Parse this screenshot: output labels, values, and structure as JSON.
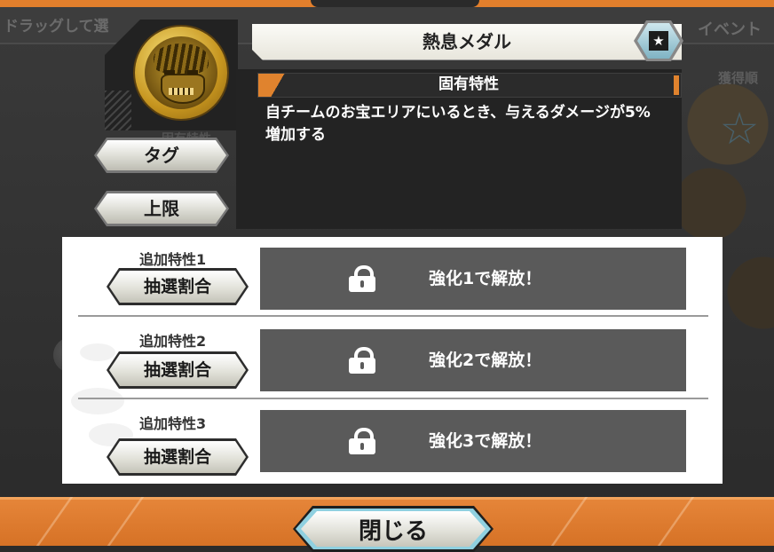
{
  "background": {
    "left_hint": "ドラッグして選",
    "right_hint": "イベント",
    "right_sub": "獲得順",
    "left_sub": "固有特性"
  },
  "medal": {
    "name": "熱息メダル",
    "icon": "medal-portrait-icon",
    "favorite_icon": "star-icon",
    "favorite_glyph": "★"
  },
  "tabs": {
    "tag_label": "タグ",
    "limit_label": "上限"
  },
  "unique_trait": {
    "heading": "固有特性",
    "description": "自チームのお宝エリアにいるとき、与えるダメージが5%増加する"
  },
  "additional_traits": [
    {
      "label": "追加特性1",
      "button_label": "抽選割合",
      "locked_text": "強化1で解放！"
    },
    {
      "label": "追加特性2",
      "button_label": "抽選割合",
      "locked_text": "強化2で解放！"
    },
    {
      "label": "追加特性3",
      "button_label": "抽選割合",
      "locked_text": "強化3で解放！"
    }
  ],
  "close_button": {
    "label": "閉じる"
  },
  "colors": {
    "frame_orange": "#e27f2c",
    "panel_dark": "#232323",
    "locked_gray": "#5a5a5a",
    "accent_blue": "#8fd0e0"
  }
}
